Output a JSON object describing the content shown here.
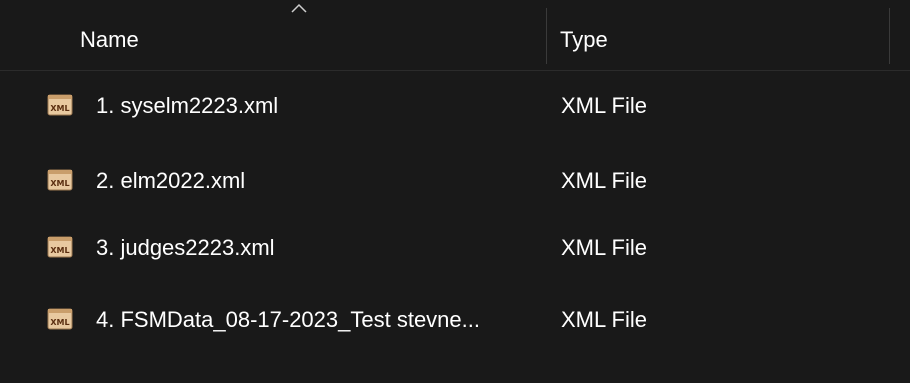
{
  "columns": {
    "name": "Name",
    "type": "Type"
  },
  "files": [
    {
      "name": "1. syselm2223.xml",
      "type": "XML File",
      "icon": "xml-file-icon"
    },
    {
      "name": "2. elm2022.xml",
      "type": "XML File",
      "icon": "xml-file-icon"
    },
    {
      "name": "3. judges2223.xml",
      "type": "XML File",
      "icon": "xml-file-icon"
    },
    {
      "name": "4. FSMData_08-17-2023_Test stevne...",
      "type": "XML File",
      "icon": "xml-file-icon"
    }
  ],
  "icon_text": "XML",
  "colors": {
    "background": "#191919",
    "text": "#ffffff",
    "icon_fill": "#e8c9a0",
    "icon_label": "#5a2e10"
  }
}
